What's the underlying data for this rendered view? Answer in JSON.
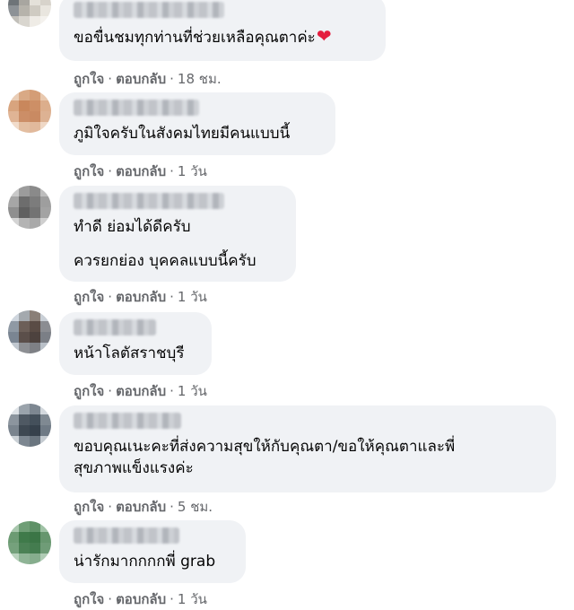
{
  "comments": [
    {
      "lines": [
        "ขอขื่นชมทุกท่านที่ช่วยเหลือคุณตาค่ะ"
      ],
      "has_heart": true,
      "heart_icon": "red-heart-emoji",
      "like_label": "ถูกใจ",
      "reply_label": "ตอบกลับ",
      "separator": "·",
      "time": "18 ชม.",
      "avatar_colors": [
        "#9aa0a3",
        "#c7c2b8",
        "#eeeae3",
        "#b8b7b0",
        "#6e7478",
        "#a8a6a0",
        "#e4e1d9",
        "#d7d3cb",
        "#8d9296",
        "#b6b3ab",
        "#cfcbc2",
        "#e9e6df",
        "#c2c0ba",
        "#d9d6cf",
        "#efece6",
        "#f4f2ee"
      ]
    },
    {
      "lines": [
        "ภูมิใจครับในสังคมไทยมีคนแบบนี้"
      ],
      "has_heart": false,
      "like_label": "ถูกใจ",
      "reply_label": "ตอบกลับ",
      "separator": "·",
      "time": "1 วัน",
      "avatar_colors": [
        "#e9cdb6",
        "#d9a985",
        "#d49d76",
        "#e8c8ae",
        "#d8a47e",
        "#c9875c",
        "#cd8f66",
        "#dcae8c",
        "#e0b495",
        "#cc8e67",
        "#c98a62",
        "#ddb293",
        "#f1dccb",
        "#e3bea1",
        "#e1b99c",
        "#efd8c6"
      ]
    },
    {
      "lines": [
        "ทำดี ย่อมได้ดีครับ",
        "",
        "ควรยกย่อง บุคคลแบบนี้ครับ"
      ],
      "has_heart": false,
      "like_label": "ถูกใจ",
      "reply_label": "ตอบกลับ",
      "separator": "·",
      "time": "1 วัน",
      "avatar_colors": [
        "#c9c9c9",
        "#9c9c9c",
        "#8a8a8a",
        "#bdbdbd",
        "#a6a6a6",
        "#6d6d6d",
        "#7c7c7c",
        "#9e9e9e",
        "#8f8f8f",
        "#5f5f5f",
        "#737373",
        "#a3a3a3",
        "#d4d4d4",
        "#b3b3b3",
        "#a9a9a9",
        "#cfcfcf"
      ]
    },
    {
      "lines": [
        "หน้าโลตัสราชบุรี"
      ],
      "has_heart": false,
      "like_label": "ถูกใจ",
      "reply_label": "ตอบกลับ",
      "separator": "·",
      "time": "1 วัน",
      "avatar_colors": [
        "#cfd6de",
        "#a4a9ae",
        "#8a7f77",
        "#c9cfd6",
        "#8f99a4",
        "#6c5f58",
        "#5a4c45",
        "#8b8d92",
        "#7a8592",
        "#5b4f4a",
        "#4d423e",
        "#7b7f86",
        "#c0c7cf",
        "#8d8f93",
        "#7e8085",
        "#b9c0c8"
      ]
    },
    {
      "lines": [
        "ขอบคุณเนะคะที่ส่งความสุขให้กับคุณตา/ขอให้คุณตาและพี่",
        "สุขภาพแข็งแรงค่ะ"
      ],
      "has_heart": false,
      "like_label": "ถูกใจ",
      "reply_label": "ตอบกลับ",
      "separator": "·",
      "time": "5 ชม.",
      "avatar_colors": [
        "#dfe3e7",
        "#9aa3ab",
        "#7d8791",
        "#d3d8dd",
        "#8c959e",
        "#4f5963",
        "#44505b",
        "#7f8992",
        "#7a848e",
        "#3e4852",
        "#36414c",
        "#6f7a85",
        "#cbd1d6",
        "#7d8791",
        "#6a757f",
        "#c4cad0"
      ]
    },
    {
      "lines": [
        "น่ารักมากกกกพี่ grab"
      ],
      "has_heart": false,
      "like_label": "ถูกใจ",
      "reply_label": "ตอบกลับ",
      "separator": "·",
      "time": "1 วัน",
      "avatar_colors": [
        "#a8c7ad",
        "#6f9e76",
        "#5f9167",
        "#9fc2a5",
        "#6c9b73",
        "#3f7a4a",
        "#3b7546",
        "#66966e",
        "#75a17c",
        "#4b8155",
        "#447c4f",
        "#6f9c77",
        "#b9d2bd",
        "#8fb496",
        "#86ad8d",
        "#b0ccb5"
      ]
    }
  ]
}
